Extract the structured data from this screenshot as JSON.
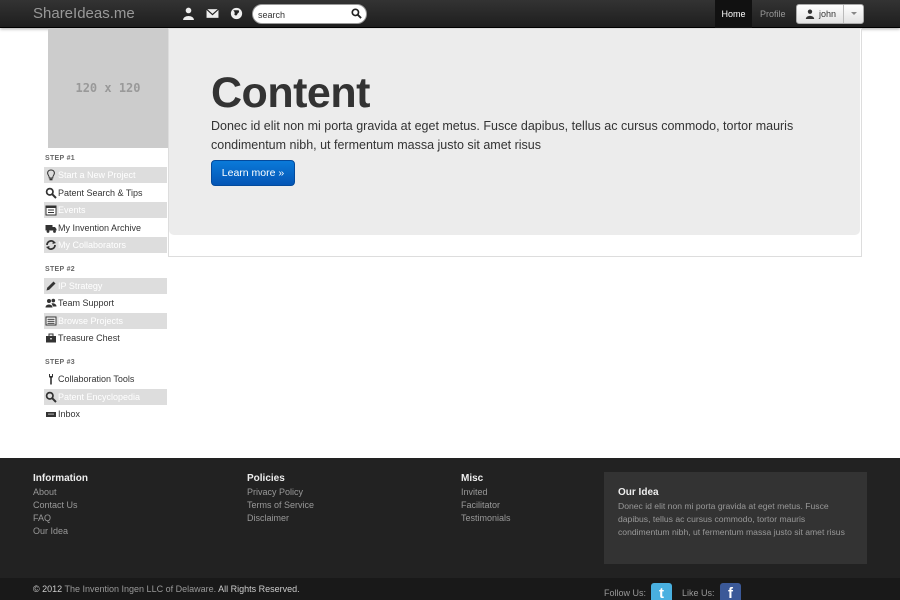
{
  "navbar": {
    "brand": "ShareIdeas.me",
    "icons": [
      "person-icon",
      "mail-icon",
      "globe-icon"
    ],
    "search_placeholder": "search",
    "search_value": "",
    "home_label": "Home",
    "profile_label": "Profile",
    "user_label": "john"
  },
  "sidebar": {
    "thumbnail_label": "120 x 120",
    "steps": [
      {
        "label": "STEP #1",
        "items": [
          {
            "label": "Start a New Project",
            "icon": "lightbulb-icon",
            "shaded": true
          },
          {
            "label": "Patent Search & Tips",
            "icon": "search-icon",
            "shaded": false
          },
          {
            "label": "Events",
            "icon": "calendar-icon",
            "shaded": true
          },
          {
            "label": "My Invention Archive",
            "icon": "truck-icon",
            "shaded": false
          },
          {
            "label": "My Collaborators",
            "icon": "refresh-icon",
            "shaded": true
          }
        ]
      },
      {
        "label": "STEP #2",
        "items": [
          {
            "label": "IP Strategy",
            "icon": "pencil-icon",
            "shaded": true
          },
          {
            "label": "Team Support",
            "icon": "group-icon",
            "shaded": false
          },
          {
            "label": "Browse Projects",
            "icon": "list-icon",
            "shaded": true
          },
          {
            "label": "Treasure Chest",
            "icon": "briefcase-icon",
            "shaded": false
          }
        ]
      },
      {
        "label": "STEP #3",
        "items": [
          {
            "label": "Collaboration Tools",
            "icon": "wrench-icon",
            "shaded": false
          },
          {
            "label": "Patent Encyclopedia",
            "icon": "search-icon",
            "shaded": true
          },
          {
            "label": "Inbox",
            "icon": "inbox-icon",
            "shaded": false
          }
        ]
      }
    ]
  },
  "hero": {
    "title": "Content",
    "text": "Donec id elit non mi porta gravida at eget metus. Fusce dapibus, tellus ac cursus commodo, tortor mauris condimentum nibh, ut fermentum massa justo sit amet risus",
    "button_label": "Learn more »",
    "button_color": "#0a6fd0"
  },
  "footer": {
    "columns": [
      {
        "title": "Information",
        "links": [
          "About",
          "Contact Us",
          "FAQ",
          "Our Idea"
        ]
      },
      {
        "title": "Policies",
        "links": [
          "Privacy Policy",
          "Terms of Service",
          "Disclaimer"
        ]
      },
      {
        "title": "Misc",
        "links": [
          "Invited",
          "Facilitator",
          "Testimonials"
        ]
      }
    ],
    "our_idea": {
      "title": "Our Idea",
      "text": "Donec id elit non mi porta gravida at eget metus. Fusce dapibus, tellus ac cursus commodo, tortor mauris condimentum nibh, ut fermentum massa justo sit amet risus"
    },
    "copyright_prefix": "© 2012",
    "copyright_owner": "The Invention Ingen LLC of Delaware.",
    "copyright_suffix": "All Rights Reserved.",
    "follow_label": "Follow Us:",
    "like_label": "Like Us:",
    "twitter_color": "#49b0e0",
    "facebook_color": "#3b5998"
  }
}
